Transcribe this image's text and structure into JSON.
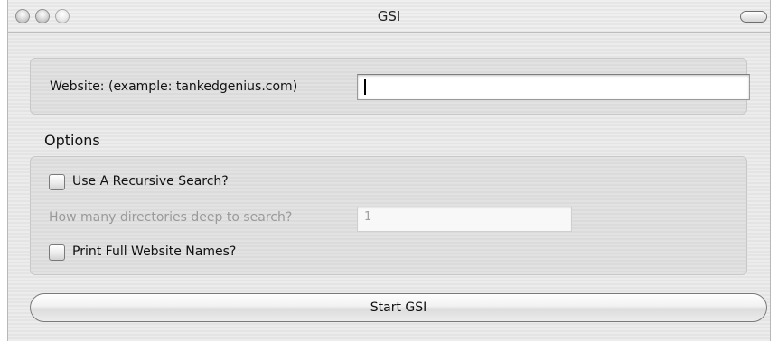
{
  "window": {
    "title": "GSI"
  },
  "website": {
    "label": "Website: (example: tankedgenius.com)",
    "value": ""
  },
  "options": {
    "heading": "Options",
    "recursive_label": "Use A Recursive Search?",
    "recursive_checked": false,
    "depth_label": "How many directories deep to search?",
    "depth_value": "1",
    "print_label": "Print Full Website Names?",
    "print_checked": false
  },
  "actions": {
    "start_label": "Start GSI"
  },
  "icons": {
    "close": "close-traffic-light-icon",
    "minimize": "minimize-traffic-light-icon",
    "zoom": "zoom-traffic-light-icon",
    "toolbar": "toolbar-toggle-icon"
  }
}
